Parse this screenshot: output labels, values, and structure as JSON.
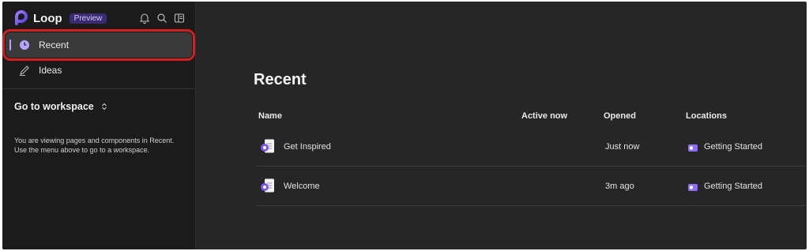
{
  "app": {
    "name": "Loop",
    "badge": "Preview"
  },
  "sidebar": {
    "items": [
      {
        "label": "Recent",
        "icon": "clock-icon",
        "selected": true
      },
      {
        "label": "Ideas",
        "icon": "pen-icon"
      }
    ],
    "workspace_heading": "Go to workspace",
    "workspace_note": "You are viewing pages and components in Recent. Use the menu above to go to a workspace."
  },
  "main": {
    "title": "Recent",
    "columns": [
      "Name",
      "Active now",
      "Opened",
      "Locations"
    ],
    "rows": [
      {
        "name": "Get Inspired",
        "active_now": "",
        "opened": "Just now",
        "location": "Getting Started"
      },
      {
        "name": "Welcome",
        "active_now": "",
        "opened": "3m ago",
        "location": "Getting Started"
      }
    ]
  },
  "colors": {
    "accent": "#b9a3ff",
    "highlight": "#d21f1f",
    "badge_bg": "#3b2a74"
  }
}
